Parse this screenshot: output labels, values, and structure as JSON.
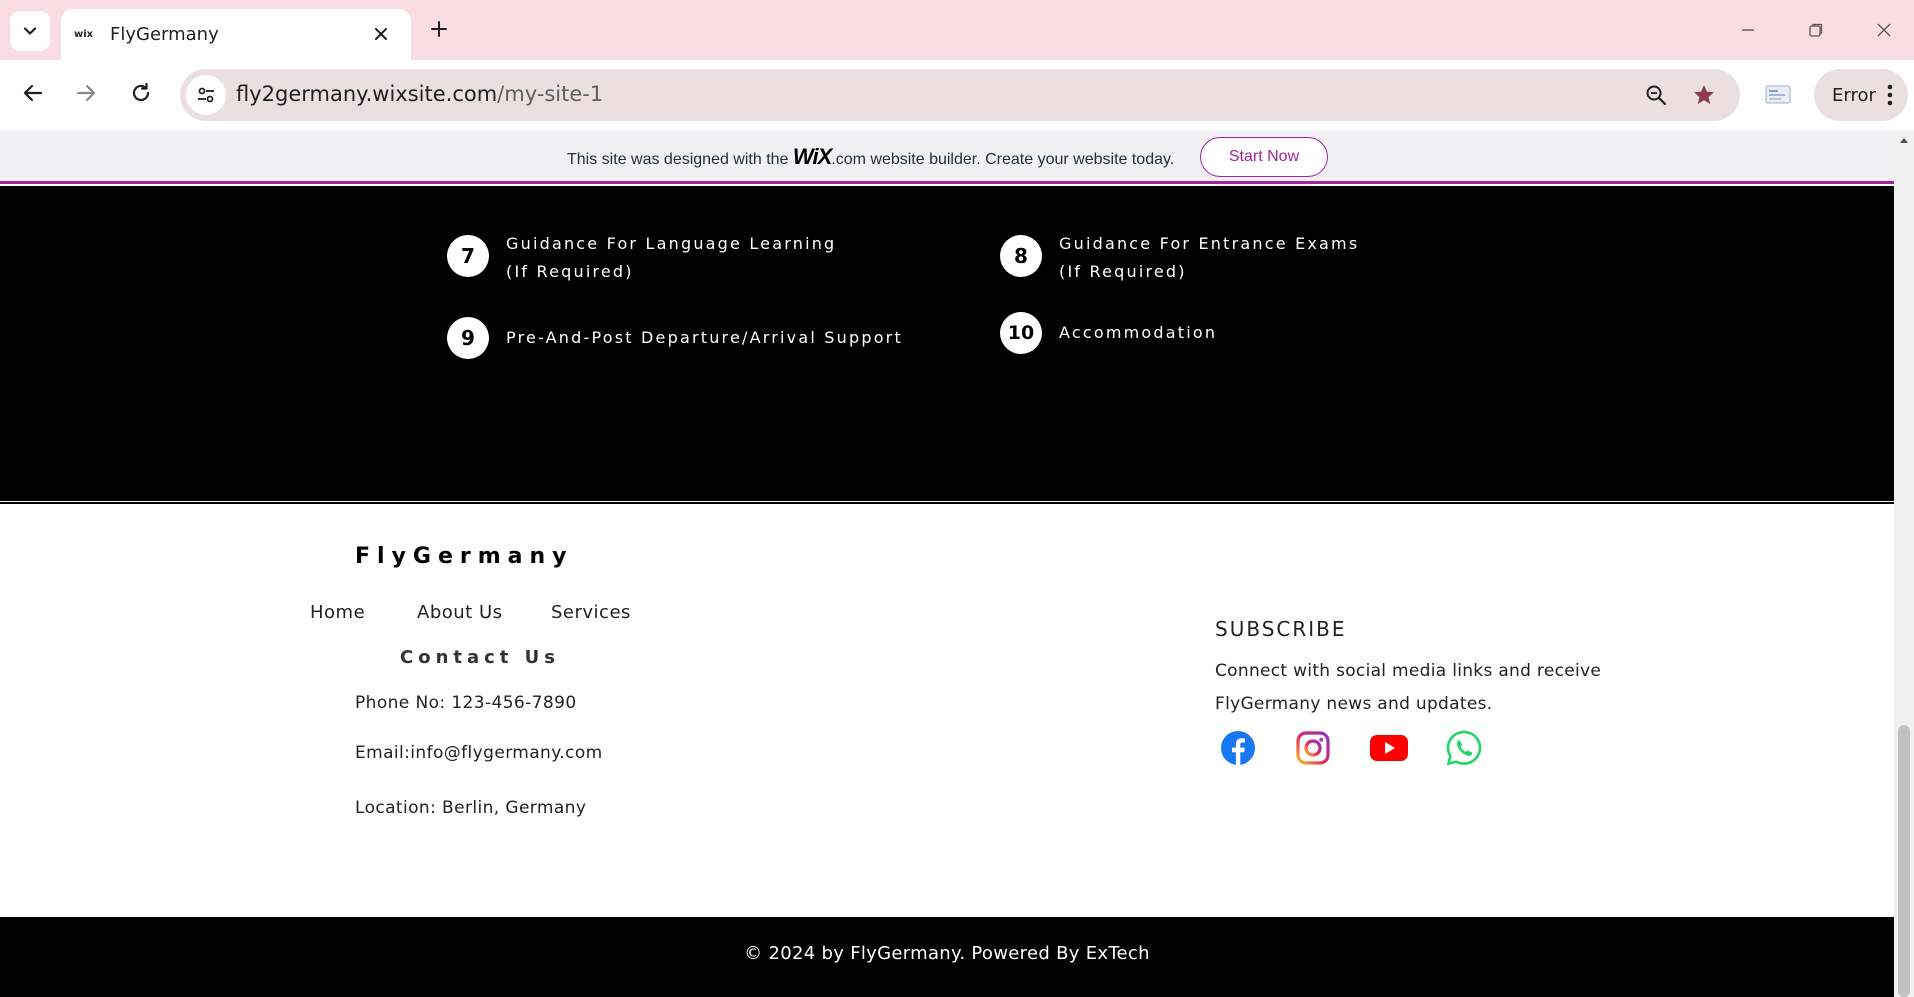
{
  "browser": {
    "tab_title": "FlyGermany",
    "tab_favicon": "wix",
    "url_host": "fly2germany.wixsite.com",
    "url_path": "/my-site-1",
    "profile_chip_label": "Error"
  },
  "wix_banner": {
    "text_before": "This site was designed with the",
    "logo": "WiX",
    "text_after": ".com website builder. Create your website today.",
    "button_label": "Start Now",
    "accent_color": "#a0249d"
  },
  "services": [
    {
      "num": "7",
      "line1": "Guidance For Language Learning",
      "line2": "(If Required)"
    },
    {
      "num": "8",
      "line1": "Guidance For Entrance Exams",
      "line2": "(If Required)"
    },
    {
      "num": "9",
      "line1": "Pre-And-Post Departure/Arrival Support",
      "line2": ""
    },
    {
      "num": "10",
      "line1": "Accommodation",
      "line2": ""
    }
  ],
  "footer": {
    "brand": "FlyGermany",
    "nav": [
      "Home",
      "About Us",
      "Services"
    ],
    "contact_title": "Contact Us",
    "phone": "Phone No: 123-456-7890",
    "email": "Email:info@flygermany.com",
    "location": "Location: Berlin, Germany",
    "subscribe_title": "SUBSCRIBE",
    "subscribe_text": "Connect with social media links and receive FlyGermany news and updates.",
    "social_icons": [
      "facebook-icon",
      "instagram-icon",
      "youtube-icon",
      "whatsapp-icon"
    ],
    "copyright": "© 2024 by FlyGermany. Powered By ExTech"
  }
}
